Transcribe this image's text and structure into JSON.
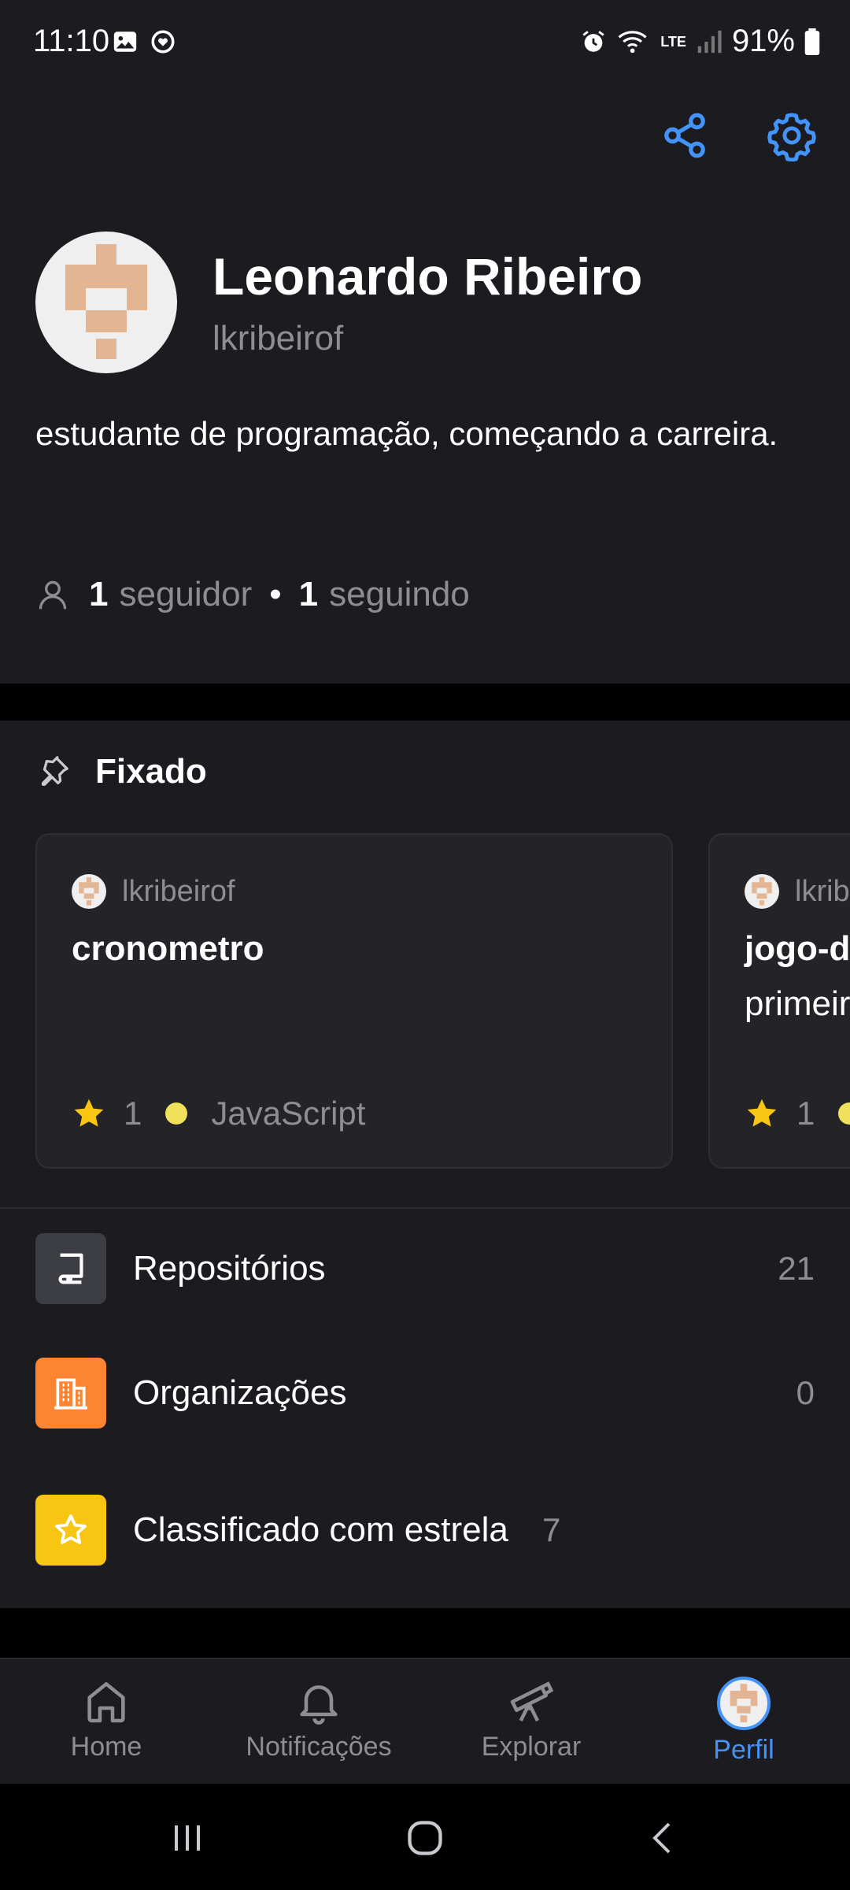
{
  "status_bar": {
    "time": "11:10",
    "battery": "91%",
    "network": "LTE"
  },
  "profile": {
    "name": "Leonardo Ribeiro",
    "username": "lkribeirof",
    "bio": "estudante de programação, começando a carreira.",
    "followers_count": "1",
    "followers_label": "seguidor",
    "following_count": "1",
    "following_label": "seguindo",
    "separator": "•"
  },
  "pinned": {
    "title": "Fixado",
    "cards": [
      {
        "owner": "lkribeirof",
        "name": "cronometro",
        "description": "",
        "stars": "1",
        "language": "JavaScript",
        "language_color": "#f1e05a"
      },
      {
        "owner": "lkrib",
        "name": "jogo-d",
        "description": "primeir",
        "stars": "1",
        "language": "",
        "language_color": "#f1e05a"
      }
    ]
  },
  "menu": [
    {
      "label": "Repositórios",
      "count": "21",
      "icon": "repo-icon",
      "color": "#3d3e44"
    },
    {
      "label": "Organizações",
      "count": "0",
      "icon": "organization-icon",
      "color": "#fb8532"
    },
    {
      "label": "Classificado com estrela",
      "count": "7",
      "icon": "star-icon",
      "color": "#f9c513"
    }
  ],
  "bottom_nav": [
    {
      "label": "Home",
      "icon": "home-icon",
      "active": false
    },
    {
      "label": "Notificações",
      "icon": "bell-icon",
      "active": false
    },
    {
      "label": "Explorar",
      "icon": "telescope-icon",
      "active": false
    },
    {
      "label": "Perfil",
      "icon": "avatar",
      "active": true
    }
  ],
  "colors": {
    "accent": "#4493f8",
    "background": "#1c1c20",
    "card": "#232328",
    "muted_text": "#8d8e93",
    "star": "#f9c513"
  }
}
